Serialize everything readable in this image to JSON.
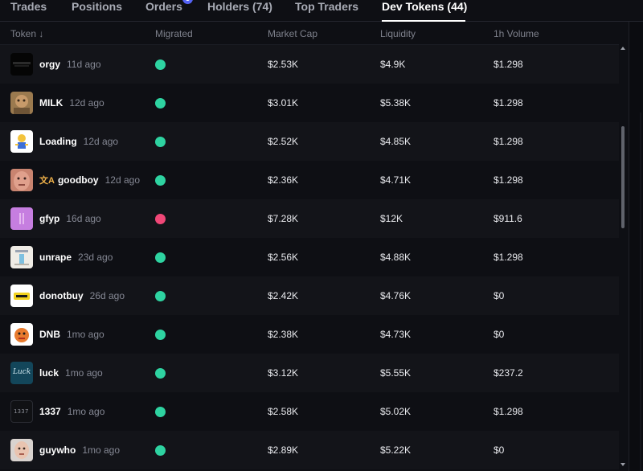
{
  "tabs": [
    {
      "label": "Trades"
    },
    {
      "label": "Positions"
    },
    {
      "label": "Orders",
      "badge": "3"
    },
    {
      "label": "Holders (74)"
    },
    {
      "label": "Top Traders"
    },
    {
      "label": "Dev Tokens (44)",
      "active": true
    }
  ],
  "table": {
    "headers": {
      "token": "Token ↓",
      "migrated": "Migrated",
      "market_cap": "Market Cap",
      "liquidity": "Liquidity",
      "volume": "1h Volume"
    },
    "rows": [
      {
        "name": "orgy",
        "age": "11d ago",
        "migrated": true,
        "market_cap": "$2.53K",
        "liquidity": "$4.9K",
        "volume": "$1.298"
      },
      {
        "name": "MILK",
        "age": "12d ago",
        "migrated": true,
        "market_cap": "$3.01K",
        "liquidity": "$5.38K",
        "volume": "$1.298"
      },
      {
        "name": "Loading",
        "age": "12d ago",
        "migrated": true,
        "market_cap": "$2.52K",
        "liquidity": "$4.85K",
        "volume": "$1.298"
      },
      {
        "name": "goodboy",
        "age": "12d ago",
        "migrated": true,
        "market_cap": "$2.36K",
        "liquidity": "$4.71K",
        "volume": "$1.298",
        "prefix": "文A"
      },
      {
        "name": "gfyp",
        "age": "16d ago",
        "migrated": false,
        "market_cap": "$7.28K",
        "liquidity": "$12K",
        "volume": "$911.6"
      },
      {
        "name": "unrape",
        "age": "23d ago",
        "migrated": true,
        "market_cap": "$2.56K",
        "liquidity": "$4.88K",
        "volume": "$1.298"
      },
      {
        "name": "donotbuy",
        "age": "26d ago",
        "migrated": true,
        "market_cap": "$2.42K",
        "liquidity": "$4.76K",
        "volume": "$0"
      },
      {
        "name": "DNB",
        "age": "1mo ago",
        "migrated": true,
        "market_cap": "$2.38K",
        "liquidity": "$4.73K",
        "volume": "$0"
      },
      {
        "name": "luck",
        "age": "1mo ago",
        "migrated": true,
        "market_cap": "$3.12K",
        "liquidity": "$5.55K",
        "volume": "$237.2"
      },
      {
        "name": "1337",
        "age": "1mo ago",
        "migrated": true,
        "market_cap": "$2.58K",
        "liquidity": "$5.02K",
        "volume": "$1.298"
      },
      {
        "name": "guywho",
        "age": "1mo ago",
        "migrated": true,
        "market_cap": "$2.89K",
        "liquidity": "$5.22K",
        "volume": "$0"
      }
    ]
  },
  "thumb_text": {
    "luck": "Luck",
    "1337": "1337"
  },
  "colors": {
    "migrated_ok": "#2ed3a1",
    "migrated_no": "#f04777",
    "badge": "#5563f5"
  }
}
